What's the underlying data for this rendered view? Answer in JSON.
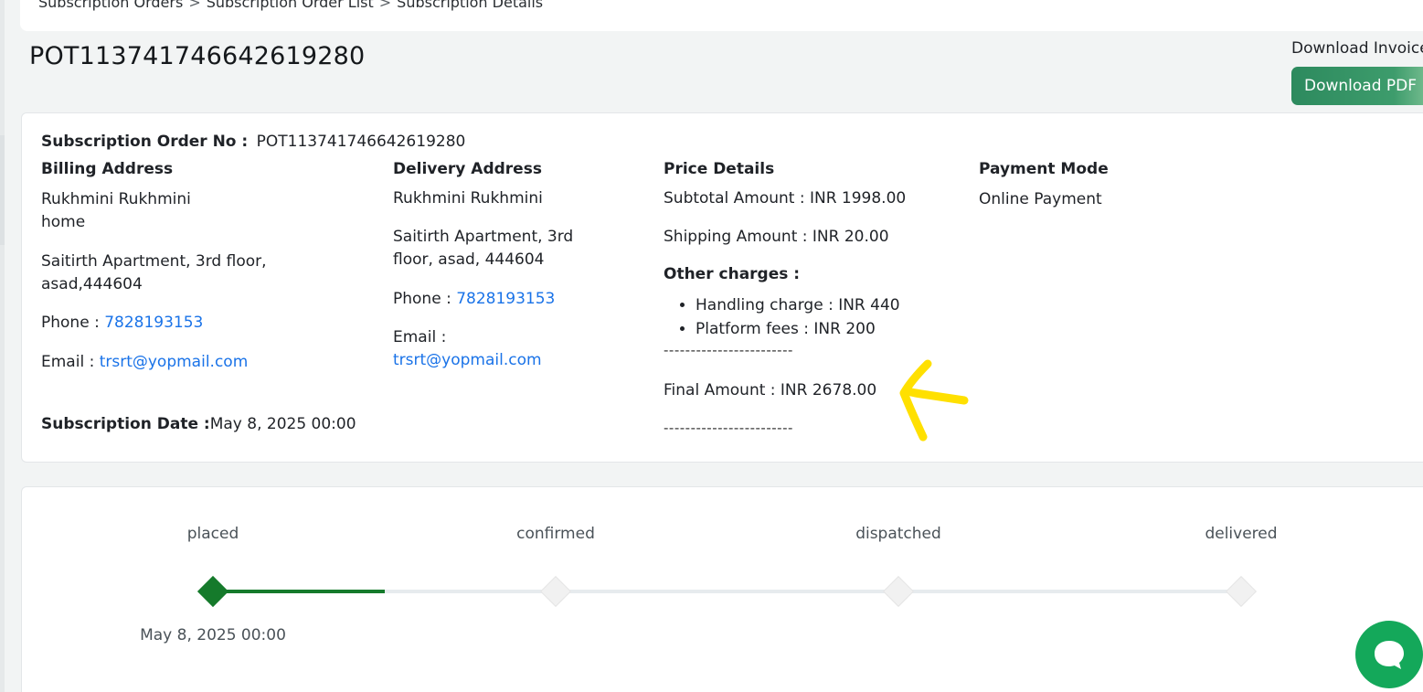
{
  "breadcrumb": [
    "Subscription Orders",
    "Subscription Order List",
    "Subscription Details"
  ],
  "breadcrumb_separator": ">",
  "page_title": "POT113741746642619280",
  "download": {
    "label": "Download Invoice",
    "button": "Download PDF"
  },
  "order": {
    "no_label": "Subscription Order No :",
    "no_value": "POT113741746642619280",
    "date_label": "Subscription Date :",
    "date_value": "May 8, 2025 00:00"
  },
  "billing": {
    "heading": "Billing Address",
    "name": "Rukhmini Rukhmini",
    "tag": "home",
    "address_line1": "Saitirth Apartment, 3rd floor,",
    "address_line2": "asad,444604",
    "phone_label": "Phone :",
    "phone": "7828193153",
    "email_label": "Email :",
    "email": "trsrt@yopmail.com"
  },
  "delivery": {
    "heading": "Delivery Address",
    "name": "Rukhmini Rukhmini",
    "address_line1": "Saitirth Apartment, 3rd",
    "address_line2": "floor, asad, 444604",
    "phone_label": "Phone :",
    "phone": "7828193153",
    "email_label": "Email :",
    "email": "trsrt@yopmail.com"
  },
  "price": {
    "heading": "Price Details",
    "subtotal": "Subtotal Amount : INR 1998.00",
    "shipping": "Shipping Amount : INR 20.00",
    "other_heading": "Other charges :",
    "charges": [
      "Handling charge :  INR  440",
      "Platform fees :  INR  200"
    ],
    "divider": "------------------------",
    "final": "Final Amount : INR  2678.00"
  },
  "payment": {
    "heading": "Payment Mode",
    "value": "Online Payment"
  },
  "tracker": {
    "stages": [
      "placed",
      "confirmed",
      "dispatched",
      "delivered"
    ],
    "active_stage_index": 0,
    "placed_date": "May 8, 2025 00:00",
    "progress_fraction": 0.167
  },
  "colors": {
    "accent_green": "#157a2b",
    "link_blue": "#1a73e8",
    "chat_green": "#14a85a",
    "annotation_yellow": "#ffe000"
  },
  "icons": {
    "chat": "chat-bubble-icon",
    "annotation": "arrow-annotation-icon"
  }
}
